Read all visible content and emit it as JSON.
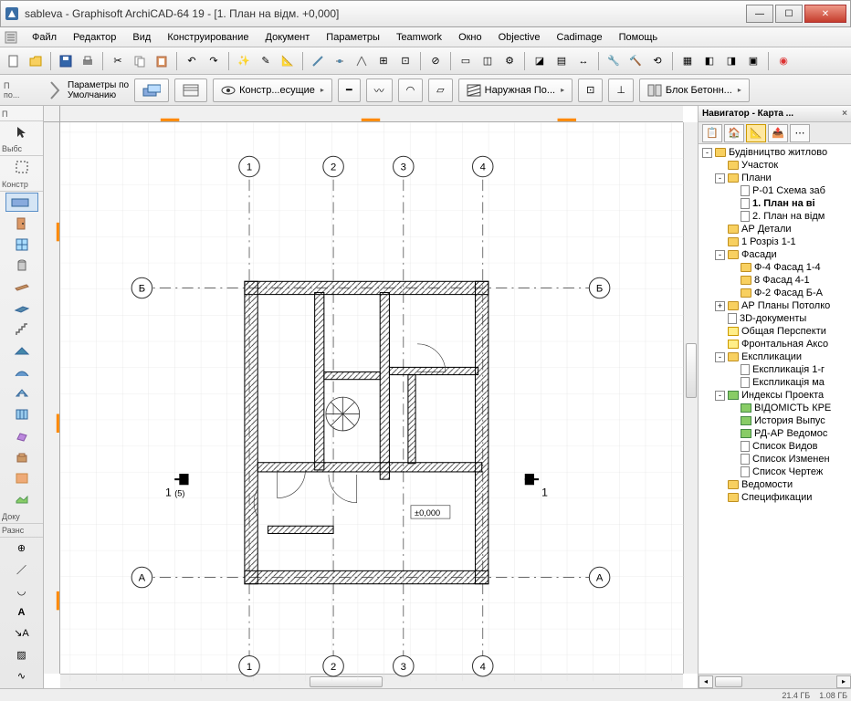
{
  "window": {
    "title": "sableva - Graphisoft ArchiCAD-64 19 - [1. План на відм. +0,000]"
  },
  "menu": [
    "Файл",
    "Редактор",
    "Вид",
    "Конструирование",
    "Документ",
    "Параметры",
    "Teamwork",
    "Окно",
    "Objective",
    "Cadimage",
    "Помощь"
  ],
  "infobar": {
    "defaults_label": "Параметры по\nУмолчанию",
    "layer": "Констр...есущие",
    "coating": "Наружная По...",
    "block": "Блок Бетонн..."
  },
  "left_toolbox": {
    "headers": [
      "П",
      "Выбс",
      "Констр",
      "Доку",
      "Разнс"
    ]
  },
  "drawing": {
    "grid_axes_num": [
      "1",
      "2",
      "3",
      "4"
    ],
    "grid_axes_letter": [
      "Б",
      "А"
    ],
    "section_marker_left": "1",
    "section_marker_left_sub": "(5)",
    "section_marker_right": "1",
    "elevation_label": "±0,000"
  },
  "navigator": {
    "title": "Навигатор - Карта ...",
    "tree": [
      {
        "d": 0,
        "exp": "-",
        "ico": "house",
        "t": "Будівництво житлово"
      },
      {
        "d": 1,
        "exp": "",
        "ico": "folder",
        "t": "Участок"
      },
      {
        "d": 1,
        "exp": "-",
        "ico": "folder",
        "t": "Плани"
      },
      {
        "d": 2,
        "exp": "",
        "ico": "page",
        "t": "Р-01 Схема заб"
      },
      {
        "d": 2,
        "exp": "",
        "ico": "page",
        "t": "1. План на ві",
        "sel": true
      },
      {
        "d": 2,
        "exp": "",
        "ico": "page",
        "t": "2. План на відм"
      },
      {
        "d": 1,
        "exp": "",
        "ico": "folder",
        "t": "АР Детали"
      },
      {
        "d": 1,
        "exp": "",
        "ico": "house",
        "t": "1 Розріз 1-1"
      },
      {
        "d": 1,
        "exp": "-",
        "ico": "folder",
        "t": "Фасади"
      },
      {
        "d": 2,
        "exp": "",
        "ico": "house",
        "t": "Ф-4 Фасад 1-4"
      },
      {
        "d": 2,
        "exp": "",
        "ico": "house",
        "t": "8 Фасад 4-1"
      },
      {
        "d": 2,
        "exp": "",
        "ico": "house",
        "t": "Ф-2 Фасад Б-А"
      },
      {
        "d": 1,
        "exp": "+",
        "ico": "folder",
        "t": "АР Планы Потолко"
      },
      {
        "d": 1,
        "exp": "",
        "ico": "page",
        "t": "3D-документы"
      },
      {
        "d": 1,
        "exp": "",
        "ico": "yel",
        "t": "Общая Перспекти"
      },
      {
        "d": 1,
        "exp": "",
        "ico": "yel",
        "t": "Фронтальная Аксо"
      },
      {
        "d": 1,
        "exp": "-",
        "ico": "folder",
        "t": "Експликации"
      },
      {
        "d": 2,
        "exp": "",
        "ico": "page",
        "t": "Експликація 1-г"
      },
      {
        "d": 2,
        "exp": "",
        "ico": "page",
        "t": "Експликація ма"
      },
      {
        "d": 1,
        "exp": "-",
        "ico": "green",
        "t": "Индексы Проекта"
      },
      {
        "d": 2,
        "exp": "",
        "ico": "green",
        "t": "ВІДОМІСТЬ КРЕ"
      },
      {
        "d": 2,
        "exp": "",
        "ico": "green",
        "t": "История Выпус"
      },
      {
        "d": 2,
        "exp": "",
        "ico": "green",
        "t": "РД-АР Ведомос"
      },
      {
        "d": 2,
        "exp": "",
        "ico": "page",
        "t": "Список Видов"
      },
      {
        "d": 2,
        "exp": "",
        "ico": "page",
        "t": "Список Изменен"
      },
      {
        "d": 2,
        "exp": "",
        "ico": "page",
        "t": "Список Чертеж"
      },
      {
        "d": 1,
        "exp": "",
        "ico": "folder",
        "t": "Ведомости"
      },
      {
        "d": 1,
        "exp": "",
        "ico": "folder",
        "t": "Спецификации"
      }
    ]
  },
  "statusbar": {
    "left": "",
    "r1": "21.4 ГБ",
    "r2": "1.08 ГБ"
  }
}
